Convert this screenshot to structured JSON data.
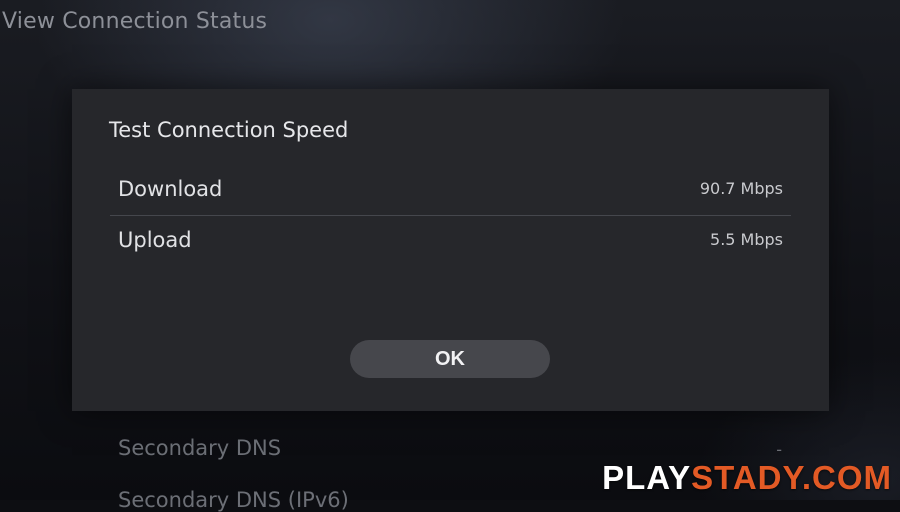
{
  "screen": {
    "title": "View Connection Status"
  },
  "background_list": {
    "items": [
      {
        "label": "Secondary DNS",
        "value": "-"
      },
      {
        "label": "Secondary DNS (IPv6)"
      }
    ]
  },
  "dialog": {
    "title": "Test Connection Speed",
    "rows": [
      {
        "label": "Download",
        "value": "90.7 Mbps"
      },
      {
        "label": "Upload",
        "value": "5.5 Mbps"
      }
    ],
    "ok_label": "OK"
  },
  "watermark": {
    "part1": "PLAY",
    "part2": "STADY.COM",
    "colors": {
      "part1": "#ffffff",
      "part2": "#e35a25"
    }
  }
}
